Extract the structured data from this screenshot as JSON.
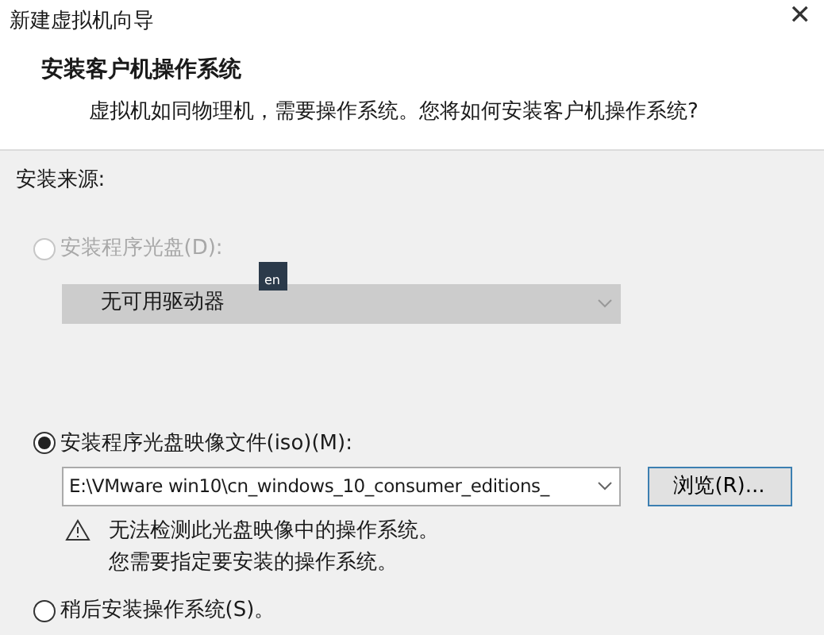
{
  "window": {
    "title": "新建虚拟机向导",
    "close": "✕"
  },
  "header": {
    "heading": "安装客户机操作系统",
    "subtitle": "虚拟机如同物理机，需要操作系统。您将如何安装客户机操作系统?"
  },
  "source_label": "安装来源:",
  "options": [
    {
      "kind": "disc",
      "label": "安装程序光盘(D):",
      "selected": false,
      "disabled": true,
      "ime_indicator": "en",
      "drive": {
        "value": "无可用驱动器",
        "disabled": true
      }
    },
    {
      "kind": "iso",
      "label": "安装程序光盘映像文件(iso)(M):",
      "selected": true,
      "disabled": false,
      "path": "E:\\VMware win10\\cn_windows_10_consumer_editions_",
      "browse": "浏览(R)...",
      "warning": [
        "无法检测此光盘映像中的操作系统。",
        "您需要指定要安装的操作系统。"
      ]
    },
    {
      "kind": "later",
      "label": "稍后安装操作系统(S)。",
      "selected": false,
      "disabled": false
    }
  ]
}
